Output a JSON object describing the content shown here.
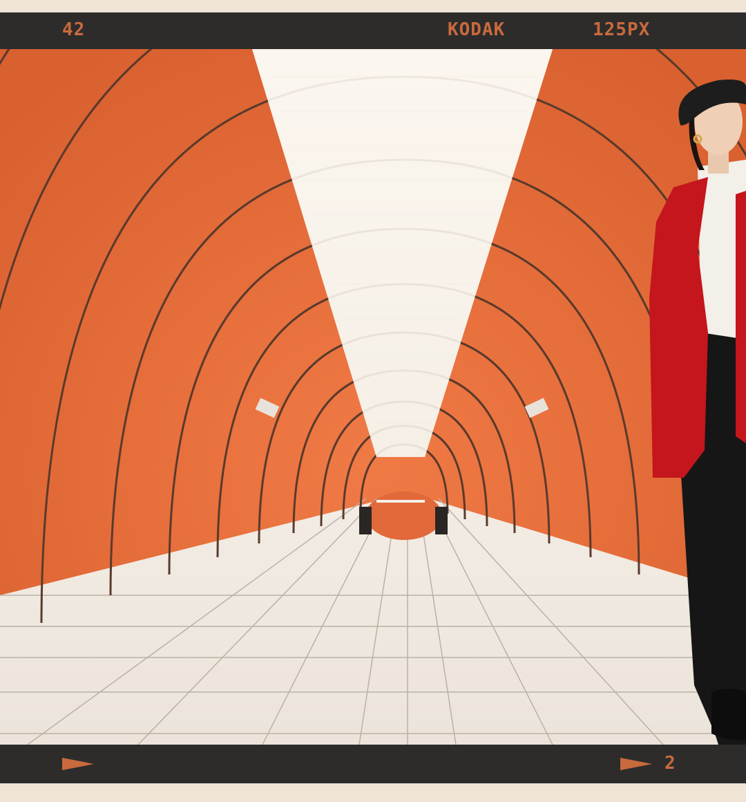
{
  "film": {
    "frame_number": "42",
    "brand": "KODAK",
    "film_code": "125PX",
    "bottom_counter": "2"
  },
  "colors": {
    "background": "#efe4d6",
    "film_strip": "#2d2c2b",
    "film_text": "#c96a3e",
    "tunnel_orange": "#e0673a",
    "coat_red": "#c4161c"
  }
}
